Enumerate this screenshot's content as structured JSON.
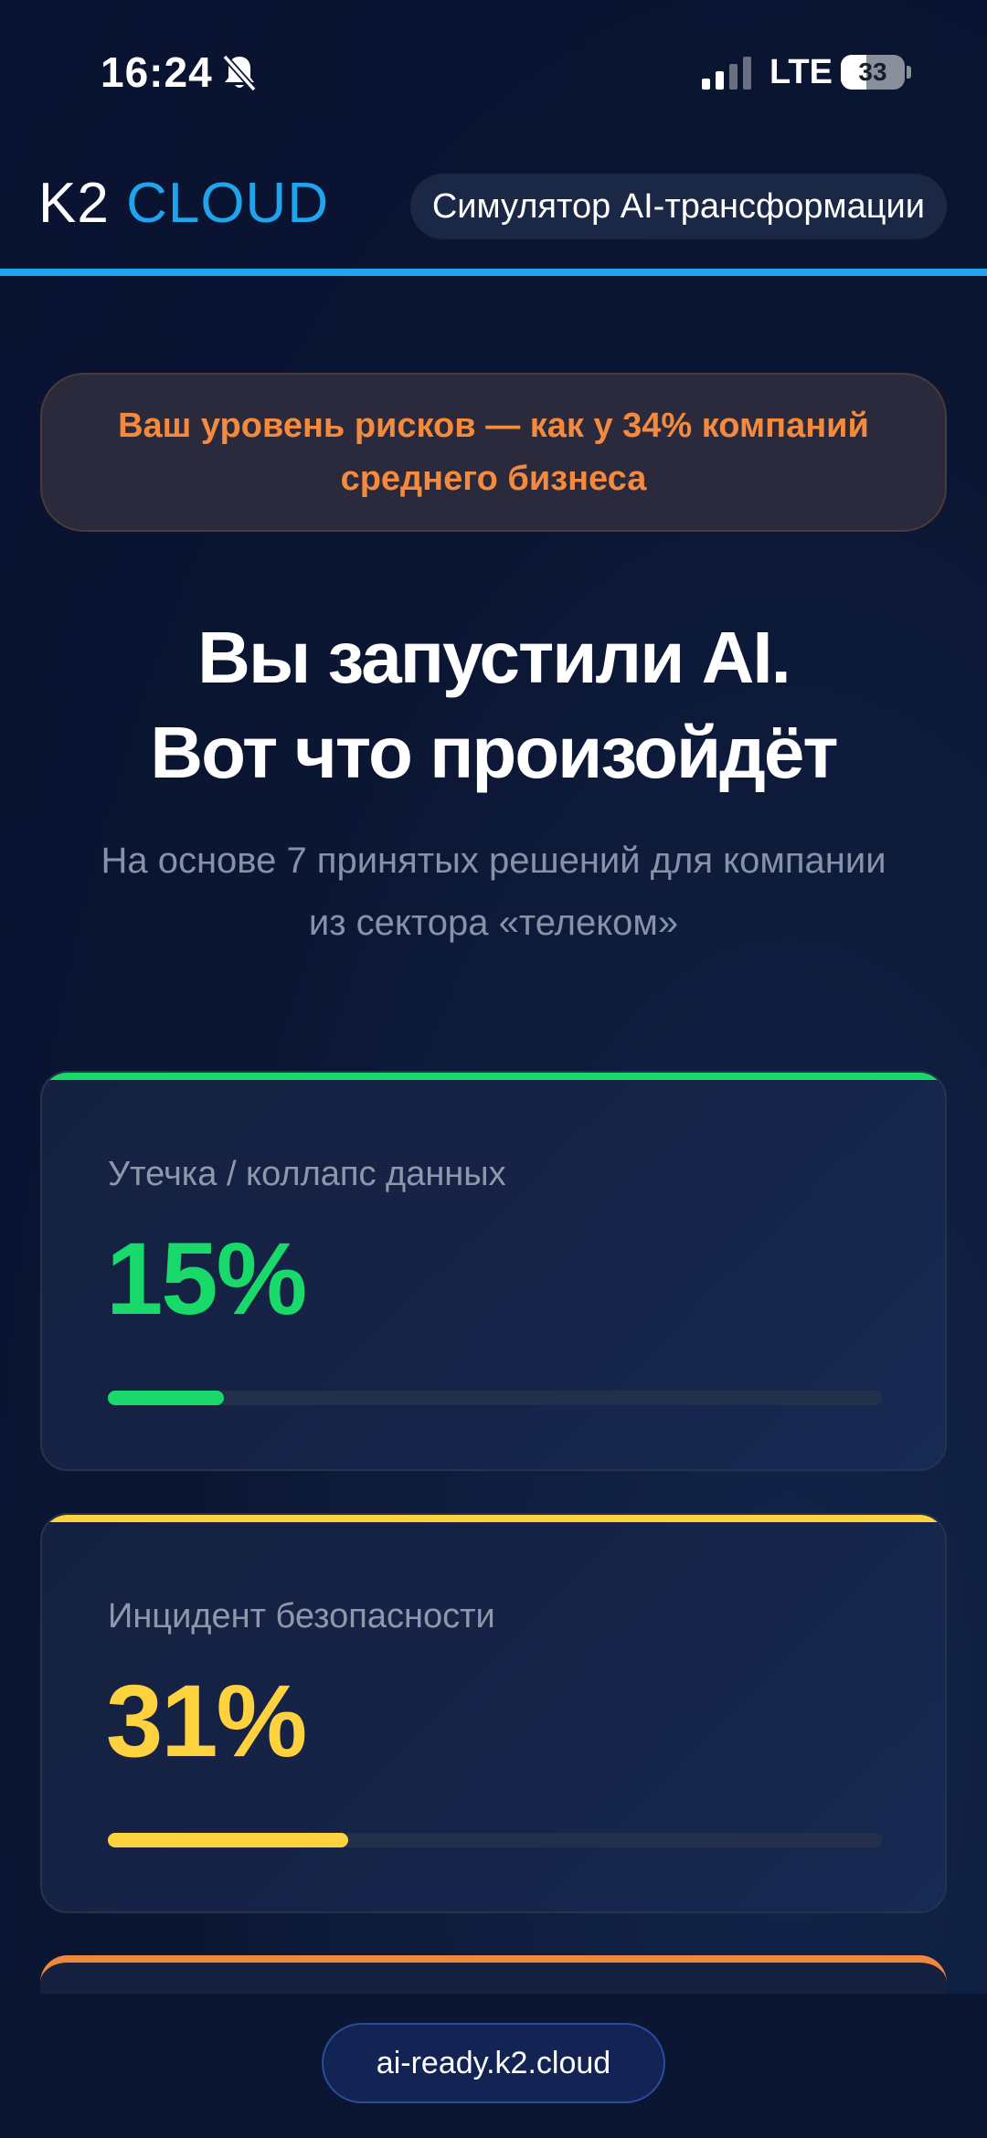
{
  "status_bar": {
    "time": "16:24",
    "network": "LTE",
    "battery": "33",
    "icons": [
      "bell-muted-icon",
      "signal-icon",
      "battery-icon"
    ]
  },
  "header": {
    "logo_k2": "K2",
    "logo_cloud": "CLOUD",
    "title_pill": "Симулятор AI-трансформации"
  },
  "risk_banner": {
    "text": "Ваш уровень рисков — как у 34% компаний среднего бизнеса"
  },
  "headline": {
    "line1": "Вы запустили AI.",
    "line2": "Вот что произойдёт"
  },
  "subhead": {
    "line1": "На основе 7 принятых решений для компании",
    "line2": "из сектора «телеком»"
  },
  "metrics": [
    {
      "label": "Утечка / коллапс данных",
      "value": "15%",
      "fraction": 0.15,
      "color": "#18d96a"
    },
    {
      "label": "Инцидент безопасности",
      "value": "31%",
      "fraction": 0.31,
      "color": "#fdd23e"
    }
  ],
  "partial_card_color": "#f0873a",
  "footer": {
    "url": "ai-ready.k2.cloud"
  },
  "colors": {
    "accent_blue": "#1ea5ee",
    "banner_text": "#f48a3e",
    "background": "#0b1633"
  }
}
